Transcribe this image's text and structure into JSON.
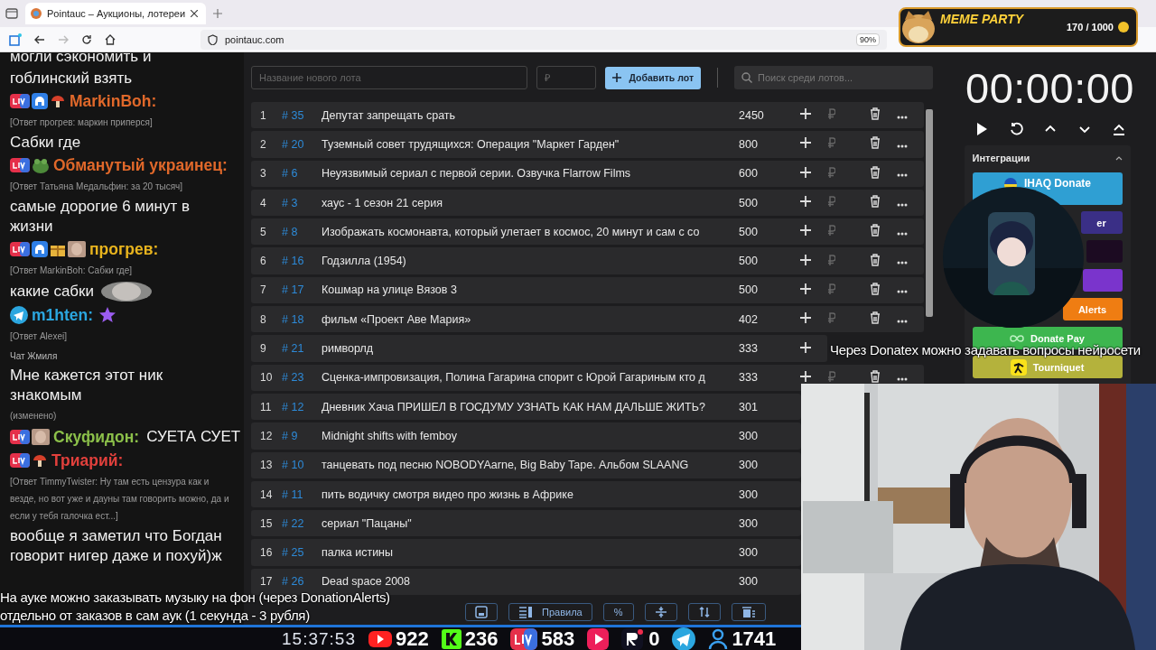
{
  "browser": {
    "tab_title": "Pointauc – Аукционы, лотереи",
    "address": "pointauc.com",
    "zoom": "90%"
  },
  "overlay_badge": {
    "title": "MEME PARTY",
    "progress": "170 / 1000"
  },
  "chat": [
    {
      "kind": "text",
      "text": "могли сэкономить и"
    },
    {
      "kind": "text",
      "text": "гоблинский взять"
    },
    {
      "kind": "author",
      "name": "MarkinBoh:",
      "color": "#e0682a"
    },
    {
      "kind": "reply",
      "text": "[Ответ прогрев: маркин приперся]"
    },
    {
      "kind": "text",
      "text": "Сабки где"
    },
    {
      "kind": "author",
      "name": "Обманутый украинец:",
      "color": "#e0682a"
    },
    {
      "kind": "reply",
      "text": "[Ответ Татьяна Медальфин: за 20 тысяч]"
    },
    {
      "kind": "text",
      "text": "самые дорогие 6 минут в жизни"
    },
    {
      "kind": "author",
      "name": "прогрев:",
      "color": "#e8b41e"
    },
    {
      "kind": "reply",
      "text": "[Ответ MarkinBoh: Сабки где]"
    },
    {
      "kind": "text",
      "text": "какие сабки",
      "emote": true
    },
    {
      "kind": "author",
      "name": "m1hten:",
      "color": "#2ba6df"
    },
    {
      "kind": "reply",
      "text": "[Ответ Alexei]"
    },
    {
      "kind": "label",
      "text": "Чат Жмиля"
    },
    {
      "kind": "text",
      "text": "Мне кажется этот ник знакомым"
    },
    {
      "kind": "note",
      "text": "(изменено)"
    },
    {
      "kind": "author",
      "name": "Скуфидон:",
      "color": "#8cc04a",
      "message": "СУЕТА СУЕТ"
    },
    {
      "kind": "author",
      "name": "Триарий:",
      "color": "#e2403c"
    },
    {
      "kind": "reply",
      "text": "[Ответ TimmyTwister: Ну там есть цензура как и везде, но вот уже и дауны там говорить можно, да и если у тебя галочка ест...]"
    },
    {
      "kind": "text",
      "text": "вообще я заметил что Богдан говорит нигер даже и похуй)ж"
    }
  ],
  "lot_form": {
    "name_placeholder": "Название нового лота",
    "price_placeholder": "₽",
    "add_button": "Добавить лот",
    "search_placeholder": "Поиск среди лотов..."
  },
  "lots": [
    {
      "index": "1",
      "id": "# 35",
      "name": "Депутат запрещать срать",
      "amount": "2450"
    },
    {
      "index": "2",
      "id": "# 20",
      "name": "Туземный совет трудящихся: Операция \"Маркет Гарден\"",
      "amount": "800"
    },
    {
      "index": "3",
      "id": "# 6",
      "name": "Неуязвимый сериал с первой серии. Озвучка Flarrow Films",
      "amount": "600"
    },
    {
      "index": "4",
      "id": "# 3",
      "name": "хаус - 1 сезон 21 серия",
      "amount": "500"
    },
    {
      "index": "5",
      "id": "# 8",
      "name": "Изображать космонавта, который улетает в космос, 20 минут и сам с со",
      "amount": "500"
    },
    {
      "index": "6",
      "id": "# 16",
      "name": "Годзилла (1954)",
      "amount": "500"
    },
    {
      "index": "7",
      "id": "# 17",
      "name": "Кошмар на улице Вязов 3",
      "amount": "500"
    },
    {
      "index": "8",
      "id": "# 18",
      "name": "фильм «Проект Аве Мария»",
      "amount": "402"
    },
    {
      "index": "9",
      "id": "# 21",
      "name": "римворлд",
      "amount": "333"
    },
    {
      "index": "10",
      "id": "# 23",
      "name": "Сценка-импровизация, Полина Гагарина спорит с Юрой Гагариным кто д",
      "amount": "333"
    },
    {
      "index": "11",
      "id": "# 12",
      "name": "Дневник Хача ПРИШЕЛ В ГОСДУМУ УЗНАТЬ КАК НАМ ДАЛЬШЕ ЖИТЬ?",
      "amount": "301"
    },
    {
      "index": "12",
      "id": "# 9",
      "name": "Midnight shifts with femboy",
      "amount": "300"
    },
    {
      "index": "13",
      "id": "# 10",
      "name": "танцевать под песню NOBODYAarne, Big Baby Tape. Альбом SLAANG",
      "amount": "300"
    },
    {
      "index": "14",
      "id": "# 11",
      "name": "пить водичку смотря видео про жизнь в Африке",
      "amount": "300"
    },
    {
      "index": "15",
      "id": "# 22",
      "name": "сериал \"Пацаны\"",
      "amount": "300"
    },
    {
      "index": "16",
      "id": "# 25",
      "name": "палка истины",
      "amount": "300"
    },
    {
      "index": "17",
      "id": "# 26",
      "name": "Dead space 2008",
      "amount": "300"
    }
  ],
  "toolbar": [
    {
      "kind": "save"
    },
    {
      "kind": "rules",
      "label": "Правила"
    },
    {
      "kind": "percent",
      "label": "%"
    },
    {
      "kind": "split"
    },
    {
      "kind": "sort"
    },
    {
      "kind": "clear"
    }
  ],
  "timer": {
    "time": "00:00:00"
  },
  "integrations": {
    "title": "Интеграции",
    "items": [
      {
        "label": "IHAQ Donate",
        "color": "#2f9fd3",
        "partly_hidden": false
      },
      {
        "label": "er",
        "color": "#3a2f86",
        "partly_hidden": true
      },
      {
        "color": "#1c0b22",
        "partly_hidden": true
      },
      {
        "color": "#7a34cc",
        "partly_hidden": true
      },
      {
        "label": "Alerts",
        "color": "#ef7d12",
        "partly_hidden": true
      },
      {
        "label": "Donate Pay",
        "color": "#3db64f",
        "partly_hidden": false
      },
      {
        "label": "Tourniquet",
        "color": "#b4b23c",
        "partly_hidden": false
      }
    ]
  },
  "captions": [
    "Через Donatex можно задавать вопросы нейросети",
    "На ауке можно заказывать музыку на фон (через DonationAlerts)",
    "отдельно от заказов в сам аук (1 секунда - 3 рубля)"
  ],
  "stream_stats": {
    "clock": "15:37:53",
    "items": [
      {
        "kind": "youtube",
        "value": "922"
      },
      {
        "kind": "kick",
        "value": "236"
      },
      {
        "kind": "live",
        "value": "583"
      },
      {
        "kind": "play"
      },
      {
        "kind": "rutube",
        "value": "0"
      },
      {
        "kind": "telegram"
      },
      {
        "kind": "viewers",
        "value": "1741"
      }
    ]
  }
}
